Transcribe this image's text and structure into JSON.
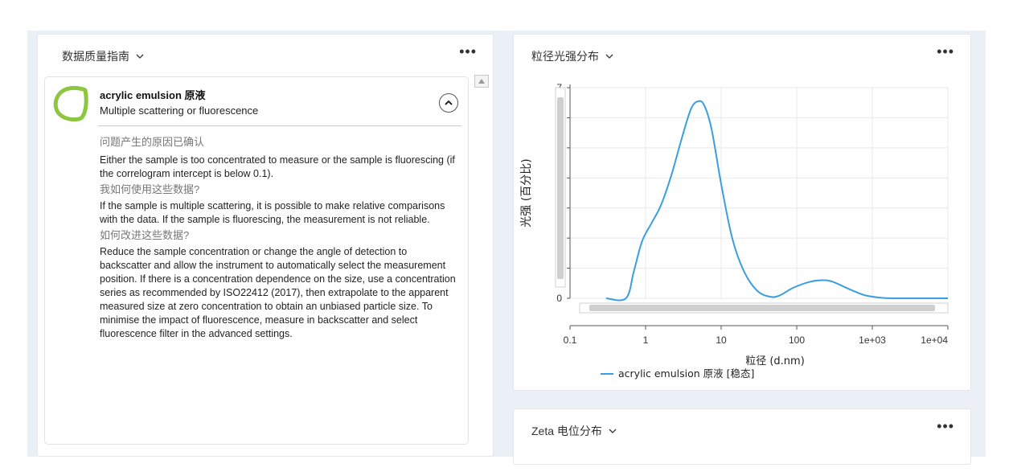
{
  "quality_panel": {
    "title": "数据质量指南",
    "more": "•••",
    "card": {
      "sample": "acrylic emulsion 原液",
      "issue": "Multiple scattering or fluorescence",
      "q1": "问题产生的原因已确认",
      "a1": "Either the sample is too concentrated to measure or the sample is fluorescing (if the correlogram intercept is below 0.1).",
      "q2": "我如何使用这些数据?",
      "a2": "If the sample is multiple scattering, it is possible to make relative comparisons with the data. If the sample is fluorescing, the measurement is not reliable.",
      "q3": "如何改进这些数据?",
      "a3": "Reduce the sample concentration or change the angle of detection to backscatter and allow the instrument to automatically select the measurement position. If there is a concentration dependence on the size, use a concentration series as recommended by ISO22412 (2017), then extrapolate to the apparent measured size at zero concentration to obtain an unbiased particle size. To minimise the impact of fluorescence, measure in backscatter and select fluorescence filter in the advanced settings.",
      "status_color": "#8dc63f"
    }
  },
  "chart_panel": {
    "title": "粒径光强分布",
    "more": "•••"
  },
  "zeta_panel": {
    "title": "Zeta 电位分布",
    "more": "•••"
  },
  "colors": {
    "series": "#3a9ee0",
    "grid": "#e8e8e8"
  },
  "chart_data": {
    "type": "line",
    "xscale": "log",
    "xlabel": "粒径 (d.nm)",
    "ylabel": "光强 (百分比)",
    "xlim": [
      0.1,
      10000
    ],
    "ylim": [
      0,
      7
    ],
    "xticks": [
      "0.1",
      "1",
      "10",
      "100",
      "1e+03",
      "1e+04"
    ],
    "yticks": [
      "0",
      "1",
      "2",
      "3",
      "4",
      "5",
      "6",
      "7"
    ],
    "grid": true,
    "legend_position": "bottom",
    "series": [
      {
        "name": "acrylic emulsion 原液 [稳态]",
        "x": [
          0.3,
          0.55,
          0.7,
          0.9,
          1.2,
          1.6,
          2.2,
          3.0,
          4.0,
          5.0,
          6.0,
          7.5,
          10,
          14,
          20,
          30,
          45,
          60,
          90,
          150,
          220,
          300,
          500,
          800,
          1300,
          2000,
          10000
        ],
        "y": [
          0,
          0,
          0.9,
          1.9,
          2.5,
          3.1,
          4.1,
          5.3,
          6.3,
          6.55,
          6.4,
          5.6,
          3.8,
          2.0,
          0.9,
          0.25,
          0.05,
          0.1,
          0.35,
          0.55,
          0.6,
          0.55,
          0.3,
          0.1,
          0.02,
          0,
          0
        ]
      }
    ]
  }
}
